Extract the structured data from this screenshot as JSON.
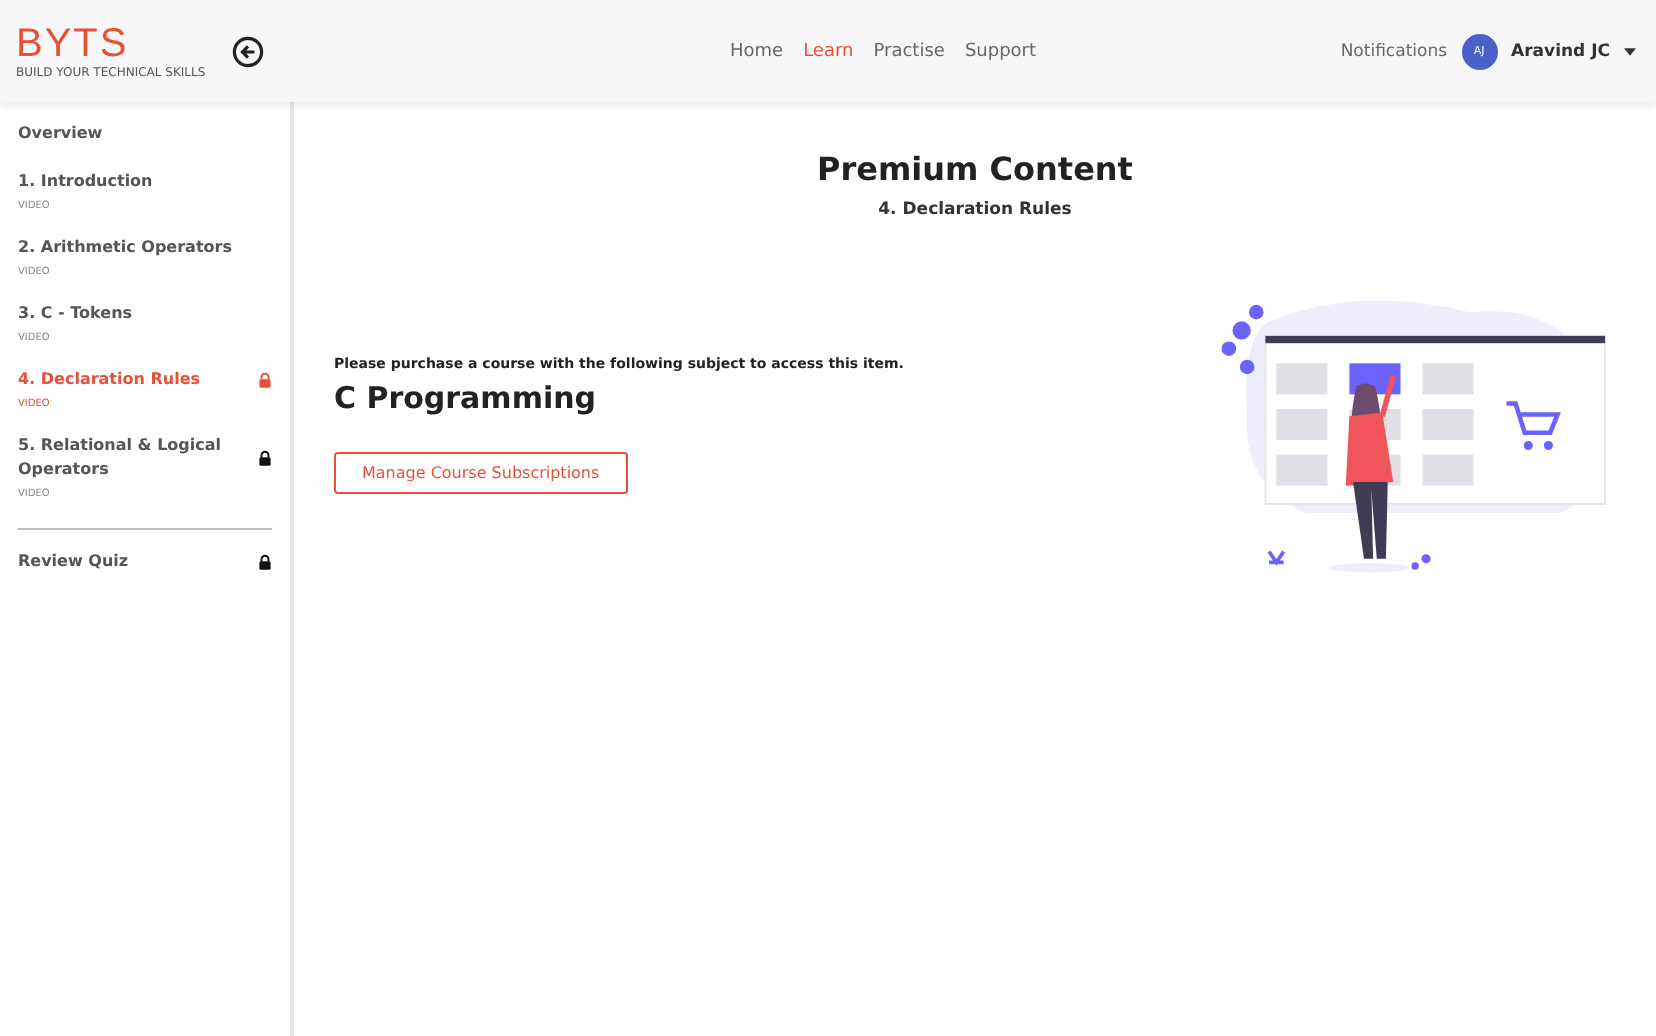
{
  "header": {
    "logo": {
      "text": "BYTS",
      "tagline": "BUILD YOUR TECHNICAL SKILLS"
    },
    "nav": [
      {
        "label": "Home",
        "selected": false
      },
      {
        "label": "Learn",
        "selected": true
      },
      {
        "label": "Practise",
        "selected": false
      },
      {
        "label": "Support",
        "selected": false
      }
    ],
    "notifications": "Notifications",
    "user": {
      "initials": "AJ",
      "name": "Aravind JC"
    }
  },
  "sidebar": {
    "items": [
      {
        "kind": "overview",
        "title": "Overview",
        "selected": false,
        "locked": false
      },
      {
        "kind": "lesson",
        "title": "1. Introduction",
        "subtitle": "VIDEO",
        "selected": false,
        "locked": false
      },
      {
        "kind": "lesson",
        "title": "2. Arithmetic Operators",
        "subtitle": "VIDEO",
        "selected": false,
        "locked": false
      },
      {
        "kind": "lesson",
        "title": "3. C - Tokens",
        "subtitle": "VIDEO",
        "selected": false,
        "locked": false
      },
      {
        "kind": "lesson",
        "title": "4. Declaration Rules",
        "subtitle": "VIDEO",
        "selected": true,
        "locked": true
      },
      {
        "kind": "lesson",
        "title": "5. Relational & Logical Operators",
        "subtitle": "VIDEO",
        "selected": false,
        "locked": true
      },
      {
        "kind": "divider"
      },
      {
        "kind": "quiz",
        "title": "Review Quiz",
        "selected": false,
        "locked": true
      }
    ]
  },
  "main": {
    "title": "Premium Content",
    "subtitle": "4. Declaration Rules",
    "message": "Please purchase a course with the following subject to access this item.",
    "subject": "C Programming",
    "button": "Manage Course Subscriptions"
  }
}
